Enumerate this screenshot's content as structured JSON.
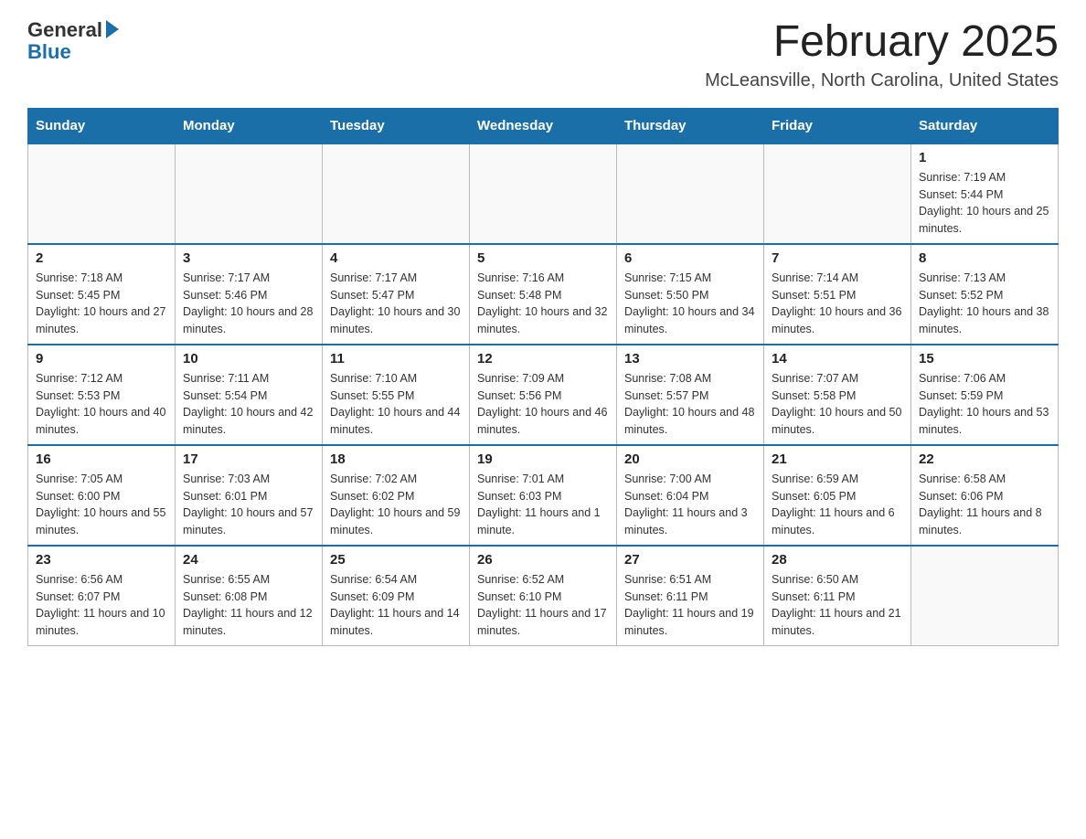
{
  "logo": {
    "general": "General",
    "blue": "Blue"
  },
  "title": "February 2025",
  "location": "McLeansville, North Carolina, United States",
  "days_of_week": [
    "Sunday",
    "Monday",
    "Tuesday",
    "Wednesday",
    "Thursday",
    "Friday",
    "Saturday"
  ],
  "weeks": [
    [
      {
        "day": "",
        "sunrise": "",
        "sunset": "",
        "daylight": "",
        "empty": true
      },
      {
        "day": "",
        "sunrise": "",
        "sunset": "",
        "daylight": "",
        "empty": true
      },
      {
        "day": "",
        "sunrise": "",
        "sunset": "",
        "daylight": "",
        "empty": true
      },
      {
        "day": "",
        "sunrise": "",
        "sunset": "",
        "daylight": "",
        "empty": true
      },
      {
        "day": "",
        "sunrise": "",
        "sunset": "",
        "daylight": "",
        "empty": true
      },
      {
        "day": "",
        "sunrise": "",
        "sunset": "",
        "daylight": "",
        "empty": true
      },
      {
        "day": "1",
        "sunrise": "Sunrise: 7:19 AM",
        "sunset": "Sunset: 5:44 PM",
        "daylight": "Daylight: 10 hours and 25 minutes.",
        "empty": false
      }
    ],
    [
      {
        "day": "2",
        "sunrise": "Sunrise: 7:18 AM",
        "sunset": "Sunset: 5:45 PM",
        "daylight": "Daylight: 10 hours and 27 minutes.",
        "empty": false
      },
      {
        "day": "3",
        "sunrise": "Sunrise: 7:17 AM",
        "sunset": "Sunset: 5:46 PM",
        "daylight": "Daylight: 10 hours and 28 minutes.",
        "empty": false
      },
      {
        "day": "4",
        "sunrise": "Sunrise: 7:17 AM",
        "sunset": "Sunset: 5:47 PM",
        "daylight": "Daylight: 10 hours and 30 minutes.",
        "empty": false
      },
      {
        "day": "5",
        "sunrise": "Sunrise: 7:16 AM",
        "sunset": "Sunset: 5:48 PM",
        "daylight": "Daylight: 10 hours and 32 minutes.",
        "empty": false
      },
      {
        "day": "6",
        "sunrise": "Sunrise: 7:15 AM",
        "sunset": "Sunset: 5:50 PM",
        "daylight": "Daylight: 10 hours and 34 minutes.",
        "empty": false
      },
      {
        "day": "7",
        "sunrise": "Sunrise: 7:14 AM",
        "sunset": "Sunset: 5:51 PM",
        "daylight": "Daylight: 10 hours and 36 minutes.",
        "empty": false
      },
      {
        "day": "8",
        "sunrise": "Sunrise: 7:13 AM",
        "sunset": "Sunset: 5:52 PM",
        "daylight": "Daylight: 10 hours and 38 minutes.",
        "empty": false
      }
    ],
    [
      {
        "day": "9",
        "sunrise": "Sunrise: 7:12 AM",
        "sunset": "Sunset: 5:53 PM",
        "daylight": "Daylight: 10 hours and 40 minutes.",
        "empty": false
      },
      {
        "day": "10",
        "sunrise": "Sunrise: 7:11 AM",
        "sunset": "Sunset: 5:54 PM",
        "daylight": "Daylight: 10 hours and 42 minutes.",
        "empty": false
      },
      {
        "day": "11",
        "sunrise": "Sunrise: 7:10 AM",
        "sunset": "Sunset: 5:55 PM",
        "daylight": "Daylight: 10 hours and 44 minutes.",
        "empty": false
      },
      {
        "day": "12",
        "sunrise": "Sunrise: 7:09 AM",
        "sunset": "Sunset: 5:56 PM",
        "daylight": "Daylight: 10 hours and 46 minutes.",
        "empty": false
      },
      {
        "day": "13",
        "sunrise": "Sunrise: 7:08 AM",
        "sunset": "Sunset: 5:57 PM",
        "daylight": "Daylight: 10 hours and 48 minutes.",
        "empty": false
      },
      {
        "day": "14",
        "sunrise": "Sunrise: 7:07 AM",
        "sunset": "Sunset: 5:58 PM",
        "daylight": "Daylight: 10 hours and 50 minutes.",
        "empty": false
      },
      {
        "day": "15",
        "sunrise": "Sunrise: 7:06 AM",
        "sunset": "Sunset: 5:59 PM",
        "daylight": "Daylight: 10 hours and 53 minutes.",
        "empty": false
      }
    ],
    [
      {
        "day": "16",
        "sunrise": "Sunrise: 7:05 AM",
        "sunset": "Sunset: 6:00 PM",
        "daylight": "Daylight: 10 hours and 55 minutes.",
        "empty": false
      },
      {
        "day": "17",
        "sunrise": "Sunrise: 7:03 AM",
        "sunset": "Sunset: 6:01 PM",
        "daylight": "Daylight: 10 hours and 57 minutes.",
        "empty": false
      },
      {
        "day": "18",
        "sunrise": "Sunrise: 7:02 AM",
        "sunset": "Sunset: 6:02 PM",
        "daylight": "Daylight: 10 hours and 59 minutes.",
        "empty": false
      },
      {
        "day": "19",
        "sunrise": "Sunrise: 7:01 AM",
        "sunset": "Sunset: 6:03 PM",
        "daylight": "Daylight: 11 hours and 1 minute.",
        "empty": false
      },
      {
        "day": "20",
        "sunrise": "Sunrise: 7:00 AM",
        "sunset": "Sunset: 6:04 PM",
        "daylight": "Daylight: 11 hours and 3 minutes.",
        "empty": false
      },
      {
        "day": "21",
        "sunrise": "Sunrise: 6:59 AM",
        "sunset": "Sunset: 6:05 PM",
        "daylight": "Daylight: 11 hours and 6 minutes.",
        "empty": false
      },
      {
        "day": "22",
        "sunrise": "Sunrise: 6:58 AM",
        "sunset": "Sunset: 6:06 PM",
        "daylight": "Daylight: 11 hours and 8 minutes.",
        "empty": false
      }
    ],
    [
      {
        "day": "23",
        "sunrise": "Sunrise: 6:56 AM",
        "sunset": "Sunset: 6:07 PM",
        "daylight": "Daylight: 11 hours and 10 minutes.",
        "empty": false
      },
      {
        "day": "24",
        "sunrise": "Sunrise: 6:55 AM",
        "sunset": "Sunset: 6:08 PM",
        "daylight": "Daylight: 11 hours and 12 minutes.",
        "empty": false
      },
      {
        "day": "25",
        "sunrise": "Sunrise: 6:54 AM",
        "sunset": "Sunset: 6:09 PM",
        "daylight": "Daylight: 11 hours and 14 minutes.",
        "empty": false
      },
      {
        "day": "26",
        "sunrise": "Sunrise: 6:52 AM",
        "sunset": "Sunset: 6:10 PM",
        "daylight": "Daylight: 11 hours and 17 minutes.",
        "empty": false
      },
      {
        "day": "27",
        "sunrise": "Sunrise: 6:51 AM",
        "sunset": "Sunset: 6:11 PM",
        "daylight": "Daylight: 11 hours and 19 minutes.",
        "empty": false
      },
      {
        "day": "28",
        "sunrise": "Sunrise: 6:50 AM",
        "sunset": "Sunset: 6:11 PM",
        "daylight": "Daylight: 11 hours and 21 minutes.",
        "empty": false
      },
      {
        "day": "",
        "sunrise": "",
        "sunset": "",
        "daylight": "",
        "empty": true
      }
    ]
  ]
}
